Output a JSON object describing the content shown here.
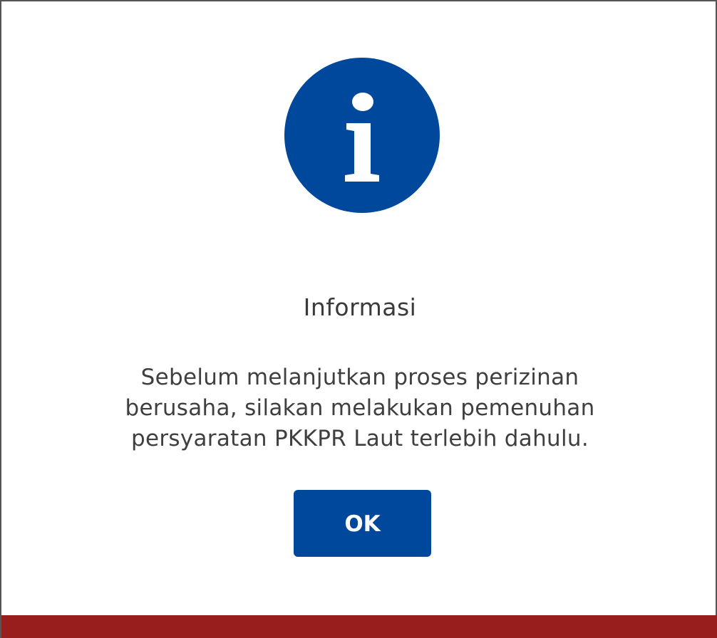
{
  "dialog": {
    "icon": "info-icon",
    "title": "Informasi",
    "message_lines": [
      "Sebelum melanjutkan proses perizinan",
      "berusaha, silakan melakukan pemenuhan",
      "persyaratan PKKPR Laut terlebih dahulu."
    ],
    "ok_label": "OK"
  },
  "colors": {
    "primary": "#00489c",
    "footer": "#981e1e",
    "text": "#3f3f3f"
  }
}
